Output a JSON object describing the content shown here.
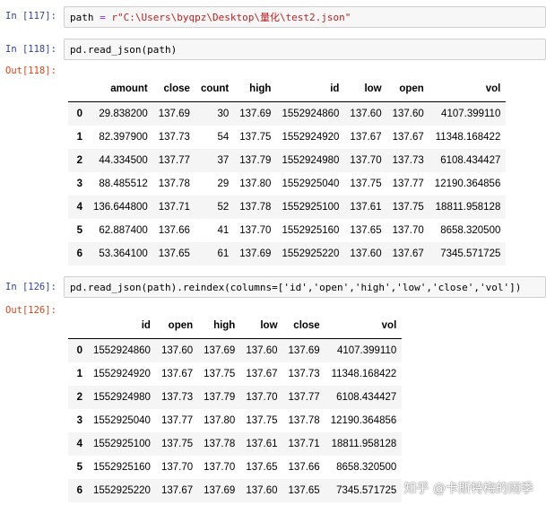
{
  "cells": [
    {
      "in_prompt": "In  [117]:",
      "code_parts": [
        "path ",
        "= ",
        "r\"C:\\Users\\byqpz\\Desktop\\量化\\test2.json\""
      ]
    },
    {
      "in_prompt": "In  [118]:",
      "code": "pd.read_json(path)",
      "out_prompt": "Out[118]:"
    },
    {
      "in_prompt": "In  [126]:",
      "code": "pd.read_json(path).reindex(columns=['id','open','high','low','close','vol'])",
      "out_prompt": "Out[126]:"
    }
  ],
  "table1": {
    "columns": [
      "",
      "amount",
      "close",
      "count",
      "high",
      "id",
      "low",
      "open",
      "vol"
    ],
    "rows": [
      [
        "0",
        "29.838200",
        "137.69",
        "30",
        "137.69",
        "1552924860",
        "137.60",
        "137.60",
        "4107.399110"
      ],
      [
        "1",
        "82.397900",
        "137.73",
        "54",
        "137.75",
        "1552924920",
        "137.67",
        "137.67",
        "11348.168422"
      ],
      [
        "2",
        "44.334500",
        "137.77",
        "37",
        "137.79",
        "1552924980",
        "137.70",
        "137.73",
        "6108.434427"
      ],
      [
        "3",
        "88.485512",
        "137.78",
        "29",
        "137.80",
        "1552925040",
        "137.75",
        "137.77",
        "12190.364856"
      ],
      [
        "4",
        "136.644800",
        "137.71",
        "52",
        "137.78",
        "1552925100",
        "137.61",
        "137.75",
        "18811.958128"
      ],
      [
        "5",
        "62.887400",
        "137.66",
        "41",
        "137.70",
        "1552925160",
        "137.65",
        "137.70",
        "8658.320500"
      ],
      [
        "6",
        "53.364100",
        "137.65",
        "61",
        "137.69",
        "1552925220",
        "137.60",
        "137.67",
        "7345.571725"
      ]
    ]
  },
  "table2": {
    "columns": [
      "",
      "id",
      "open",
      "high",
      "low",
      "close",
      "vol"
    ],
    "rows": [
      [
        "0",
        "1552924860",
        "137.60",
        "137.69",
        "137.60",
        "137.69",
        "4107.399110"
      ],
      [
        "1",
        "1552924920",
        "137.67",
        "137.75",
        "137.67",
        "137.73",
        "11348.168422"
      ],
      [
        "2",
        "1552924980",
        "137.73",
        "137.79",
        "137.70",
        "137.77",
        "6108.434427"
      ],
      [
        "3",
        "1552925040",
        "137.77",
        "137.80",
        "137.75",
        "137.78",
        "12190.364856"
      ],
      [
        "4",
        "1552925100",
        "137.75",
        "137.78",
        "137.61",
        "137.71",
        "18811.958128"
      ],
      [
        "5",
        "1552925160",
        "137.70",
        "137.70",
        "137.65",
        "137.66",
        "8658.320500"
      ],
      [
        "6",
        "1552925220",
        "137.67",
        "137.69",
        "137.60",
        "137.65",
        "7345.571725"
      ]
    ]
  },
  "watermark": "知乎 @卡斯特梅的雨季"
}
